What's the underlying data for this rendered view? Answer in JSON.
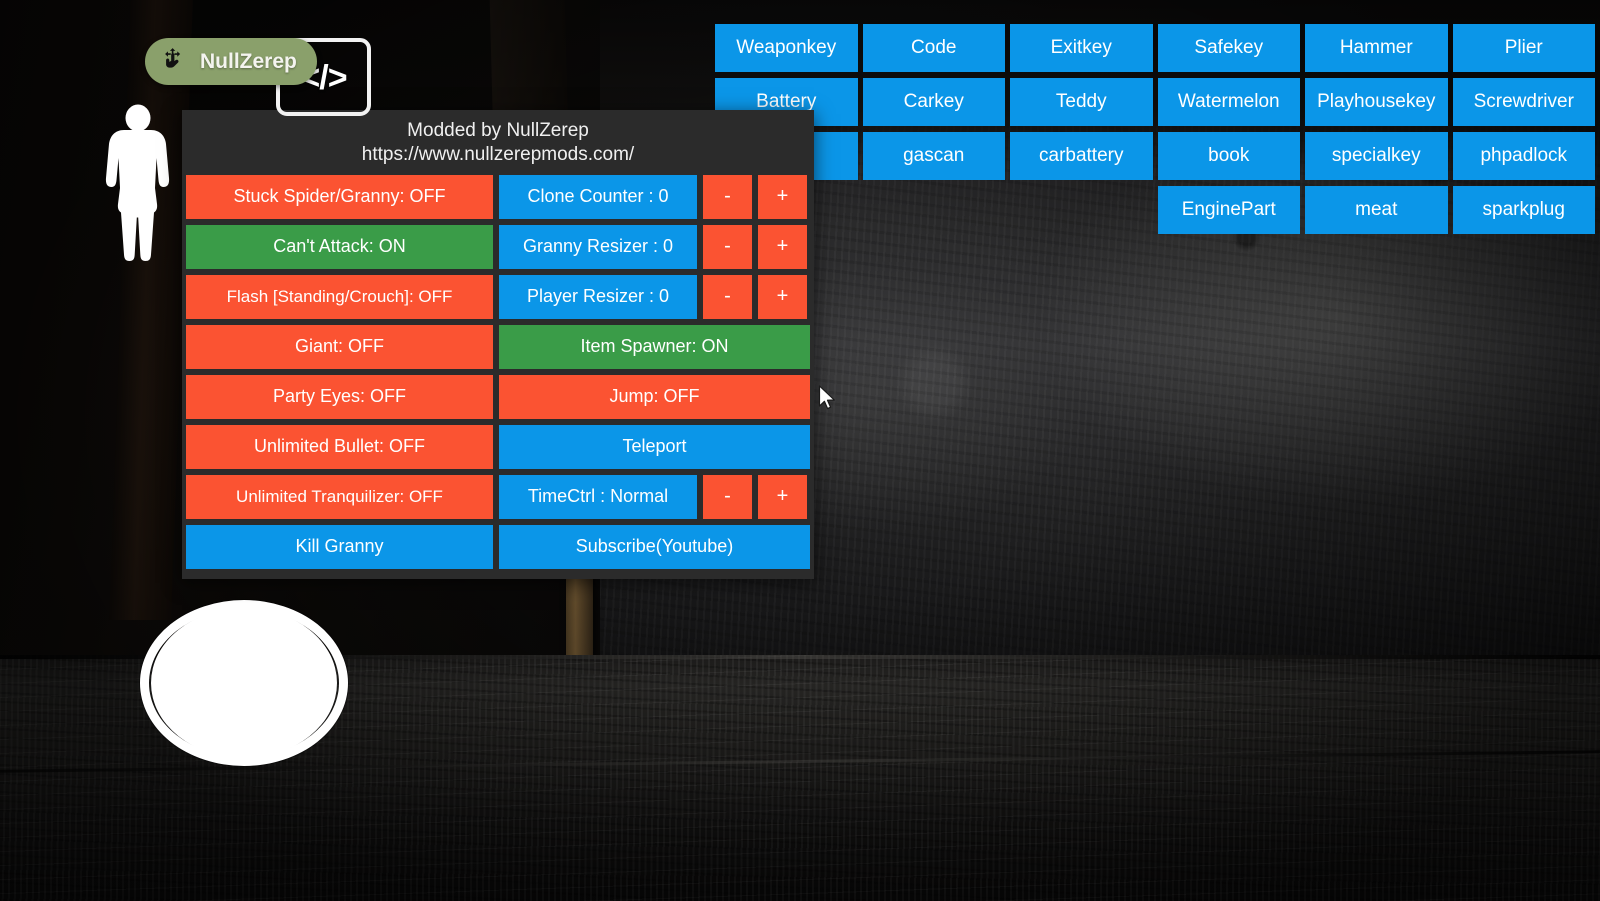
{
  "overlay": {
    "drag_badge": {
      "label": "NullZerep",
      "icon": "drag-move-hand-icon"
    },
    "code_icon": {
      "glyph": "</>",
      "icon": "code-brackets-icon"
    },
    "player_icon": "player-silhouette-icon",
    "joystick": "movement-joystick"
  },
  "menu": {
    "header": {
      "line1": "Modded by NullZerep",
      "line2": "https://www.nullzerepmods.com/"
    },
    "rows": [
      {
        "left": {
          "label": "Stuck Spider/Granny: OFF",
          "state": "off",
          "color": "red",
          "name": "toggle-stuck-spider-granny"
        },
        "right": {
          "type": "stepper",
          "label": "Clone Counter : 0",
          "value": "0",
          "color": "blue",
          "name": "clone-counter",
          "minus": "-",
          "plus": "+"
        }
      },
      {
        "left": {
          "label": "Can't Attack: ON",
          "state": "on",
          "color": "green",
          "name": "toggle-cant-attack"
        },
        "right": {
          "type": "stepper",
          "label": "Granny Resizer : 0",
          "value": "0",
          "color": "blue",
          "name": "granny-resizer",
          "minus": "-",
          "plus": "+"
        }
      },
      {
        "left": {
          "label": "Flash [Standing/Crouch]: OFF",
          "state": "off",
          "color": "red",
          "name": "toggle-flash-standing-crouch"
        },
        "right": {
          "type": "stepper",
          "label": "Player Resizer : 0",
          "value": "0",
          "color": "blue",
          "name": "player-resizer",
          "minus": "-",
          "plus": "+"
        }
      },
      {
        "left": {
          "label": "Giant: OFF",
          "state": "off",
          "color": "red",
          "name": "toggle-giant"
        },
        "right": {
          "type": "full",
          "label": "Item Spawner: ON",
          "state": "on",
          "color": "green",
          "name": "toggle-item-spawner"
        }
      },
      {
        "left": {
          "label": "Party Eyes: OFF",
          "state": "off",
          "color": "red",
          "name": "toggle-party-eyes"
        },
        "right": {
          "type": "full",
          "label": "Jump: OFF",
          "state": "off",
          "color": "red",
          "name": "toggle-jump"
        }
      },
      {
        "left": {
          "label": "Unlimited Bullet: OFF",
          "state": "off",
          "color": "red",
          "name": "toggle-unlimited-bullet"
        },
        "right": {
          "type": "full",
          "label": "Teleport",
          "color": "blue",
          "name": "teleport-button"
        }
      },
      {
        "left": {
          "label": "Unlimited Tranquilizer: OFF",
          "state": "off",
          "color": "red",
          "name": "toggle-unlimited-tranquilizer"
        },
        "right": {
          "type": "stepper",
          "label": "TimeCtrl : Normal",
          "value": "Normal",
          "color": "blue",
          "name": "time-control",
          "minus": "-",
          "plus": "+"
        }
      },
      {
        "left": {
          "label": "Kill Granny",
          "color": "blue",
          "name": "kill-granny-button"
        },
        "right": {
          "type": "full",
          "label": "Subscribe(Youtube)",
          "color": "blue",
          "name": "subscribe-youtube-button"
        }
      }
    ]
  },
  "item_spawner": {
    "items": [
      {
        "label": "Weaponkey",
        "visible": true
      },
      {
        "label": "Code",
        "visible": true
      },
      {
        "label": "Exitkey",
        "visible": true
      },
      {
        "label": "Safekey",
        "visible": true
      },
      {
        "label": "Hammer",
        "visible": true
      },
      {
        "label": "Plier",
        "visible": true
      },
      {
        "label": "Battery",
        "visible": true
      },
      {
        "label": "Carkey",
        "visible": true
      },
      {
        "label": "Teddy",
        "visible": true
      },
      {
        "label": "Watermelon",
        "visible": true
      },
      {
        "label": "Playhousekey",
        "visible": true
      },
      {
        "label": "Screwdriver",
        "visible": true
      },
      {
        "label": "",
        "visible": true
      },
      {
        "label": "gascan",
        "visible": true
      },
      {
        "label": "carbattery",
        "visible": true
      },
      {
        "label": "book",
        "visible": true
      },
      {
        "label": "specialkey",
        "visible": true
      },
      {
        "label": "phpadlock",
        "visible": true
      },
      {
        "label": "",
        "visible": false
      },
      {
        "label": "",
        "visible": false
      },
      {
        "label": "",
        "visible": false
      },
      {
        "label": "EnginePart",
        "visible": true
      },
      {
        "label": "meat",
        "visible": true
      },
      {
        "label": "sparkplug",
        "visible": true
      }
    ]
  },
  "colors": {
    "red": "#fb5332",
    "green": "#3a9c48",
    "blue": "#0b96e8",
    "panel_bg": "#2b2b2b",
    "badge_green": "#8aa06b",
    "text": "#ffffff"
  }
}
